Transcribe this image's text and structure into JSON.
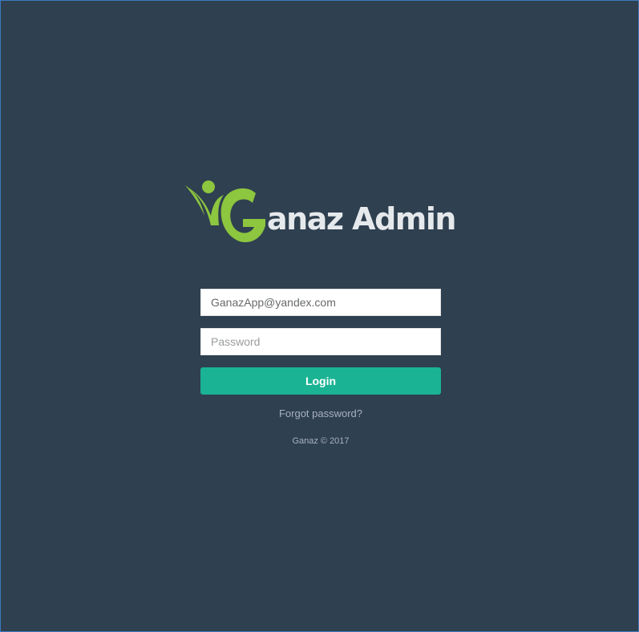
{
  "app": {
    "brand_name": "anaz Admin",
    "brand_initial": "G"
  },
  "form": {
    "email_value": "GanazApp@yandex.com",
    "password_placeholder": "Password",
    "login_label": "Login",
    "forgot_label": "Forgot password?"
  },
  "footer": {
    "copyright": "Ganaz © 2017"
  },
  "colors": {
    "background": "#2f4050",
    "accent": "#1ab394",
    "logo_green": "#8dc63f",
    "muted_text": "#a7b1c2"
  },
  "icons": {
    "logo": "ganaz-logo-icon"
  }
}
